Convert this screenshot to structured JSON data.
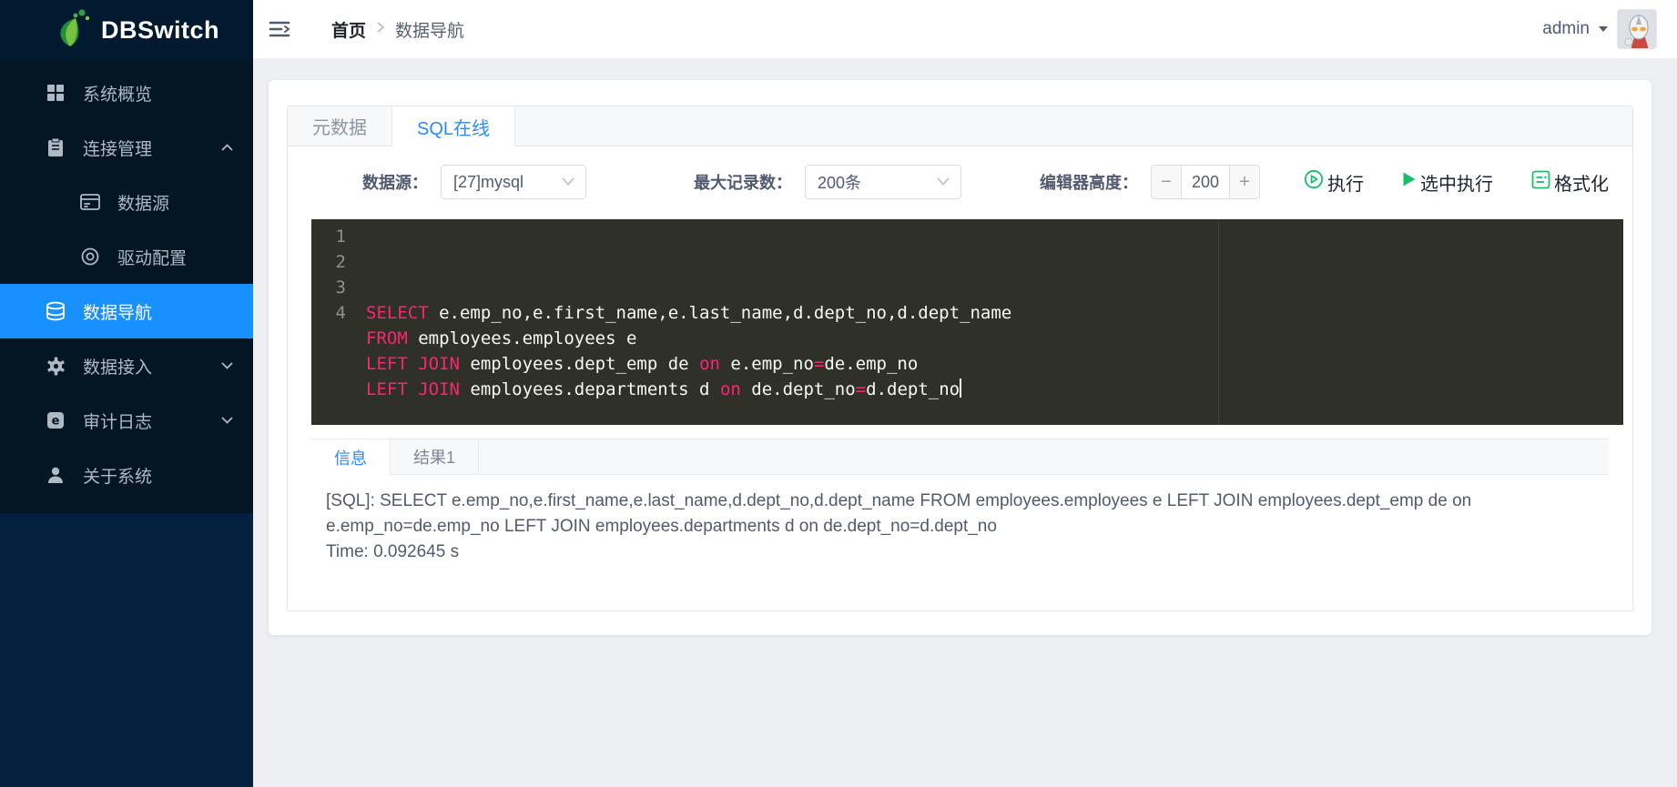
{
  "app": {
    "name": "DBSwitch"
  },
  "colors": {
    "accent": "#2d8cf0",
    "sidebar_active": "#1890ff",
    "success_green": "#19be6b",
    "sql_keyword": "#f92672",
    "editor_background": "#2f3129"
  },
  "sidebar": {
    "items": [
      {
        "id": "system-overview",
        "label": "系统概览",
        "icon": "grid-icon"
      },
      {
        "id": "connection-management",
        "label": "连接管理",
        "icon": "clipboard-icon",
        "chevron": "up",
        "children": [
          {
            "id": "datasource",
            "label": "数据源",
            "icon": "server-card-icon"
          },
          {
            "id": "driver-config",
            "label": "驱动配置",
            "icon": "disc-icon"
          }
        ]
      },
      {
        "id": "data-navigation",
        "label": "数据导航",
        "icon": "database-icon",
        "active": true
      },
      {
        "id": "data-access",
        "label": "数据接入",
        "icon": "gear-icon",
        "chevron": "down"
      },
      {
        "id": "audit-log",
        "label": "审计日志",
        "icon": "audit-icon",
        "chevron": "down"
      },
      {
        "id": "about-system",
        "label": "关于系统",
        "icon": "user-icon"
      }
    ]
  },
  "header": {
    "breadcrumb": {
      "home": "首页",
      "current": "数据导航"
    },
    "username": "admin"
  },
  "tabs": {
    "metadata": "元数据",
    "sql_online": "SQL在线"
  },
  "toolbar": {
    "datasource_label": "数据源：",
    "datasource_value": "[27]mysql",
    "max_records_label": "最大记录数：",
    "max_records_value": "200条",
    "editor_height_label": "编辑器高度：",
    "editor_height_value": "200",
    "minus_label": "−",
    "plus_label": "+",
    "run_label": "执行",
    "run_selected_label": "选中执行",
    "format_label": "格式化"
  },
  "editor": {
    "lines": [
      {
        "tokens": [
          {
            "t": "k",
            "s": "SELECT"
          },
          {
            "t": "p",
            "s": " e.emp_no,e.first_name,e.last_name,d.dept_no,d.dept_name"
          }
        ]
      },
      {
        "tokens": [
          {
            "t": "k",
            "s": "FROM"
          },
          {
            "t": "p",
            "s": " employees.employees e"
          }
        ]
      },
      {
        "tokens": [
          {
            "t": "k",
            "s": "LEFT JOIN"
          },
          {
            "t": "p",
            "s": " employees.dept_emp de "
          },
          {
            "t": "k",
            "s": "on"
          },
          {
            "t": "p",
            "s": " e.emp_no"
          },
          {
            "t": "k",
            "s": "="
          },
          {
            "t": "p",
            "s": "de.emp_no"
          }
        ]
      },
      {
        "tokens": [
          {
            "t": "k",
            "s": "LEFT JOIN"
          },
          {
            "t": "p",
            "s": " employees.departments d "
          },
          {
            "t": "k",
            "s": "on"
          },
          {
            "t": "p",
            "s": " de.dept_no"
          },
          {
            "t": "k",
            "s": "="
          },
          {
            "t": "p",
            "s": "d.dept_no"
          }
        ],
        "cursor": true
      }
    ]
  },
  "results": {
    "info_tab": "信息",
    "result_tab": "结果1",
    "message": "[SQL]: SELECT e.emp_no,e.first_name,e.last_name,d.dept_no,d.dept_name FROM employees.employees e LEFT JOIN employees.dept_emp de on e.emp_no=de.emp_no LEFT JOIN employees.departments d on de.dept_no=d.dept_no",
    "time": "Time: 0.092645 s"
  }
}
